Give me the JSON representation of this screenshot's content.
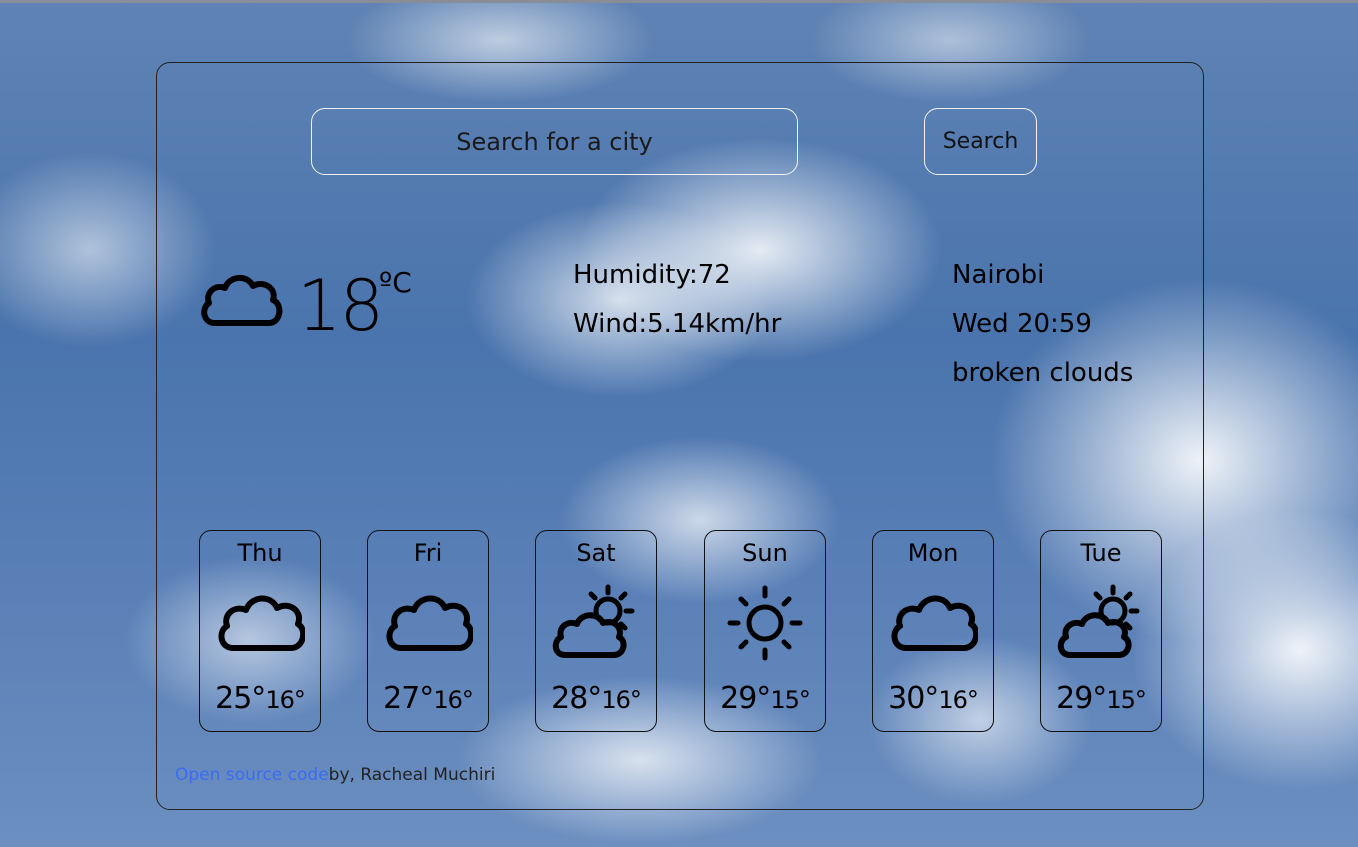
{
  "search": {
    "placeholder": "Search for a city",
    "button_label": "Search"
  },
  "current": {
    "icon": "cloud-icon",
    "temperature": "18",
    "unit": "ºC",
    "humidity_label": "Humidity:72",
    "wind_label": "Wind:5.14km/hr",
    "city": "Nairobi",
    "datetime": "Wed 20:59",
    "description": "broken clouds"
  },
  "forecast": [
    {
      "day": "Thu",
      "icon": "cloud-icon",
      "max": "25°",
      "min": "16°"
    },
    {
      "day": "Fri",
      "icon": "cloud-icon",
      "max": "27°",
      "min": "16°"
    },
    {
      "day": "Sat",
      "icon": "partly-sunny-icon",
      "max": "28°",
      "min": "16°"
    },
    {
      "day": "Sun",
      "icon": "sun-icon",
      "max": "29°",
      "min": "15°"
    },
    {
      "day": "Mon",
      "icon": "cloud-icon",
      "max": "30°",
      "min": "16°"
    },
    {
      "day": "Tue",
      "icon": "partly-sunny-icon",
      "max": "29°",
      "min": "15°"
    }
  ],
  "footer": {
    "link_text": "Open source code",
    "credit": "by, Racheal Muchiri"
  },
  "colors": {
    "link": "#3b6cf2",
    "border": "#111111",
    "input_border": "#f2f2f2"
  }
}
